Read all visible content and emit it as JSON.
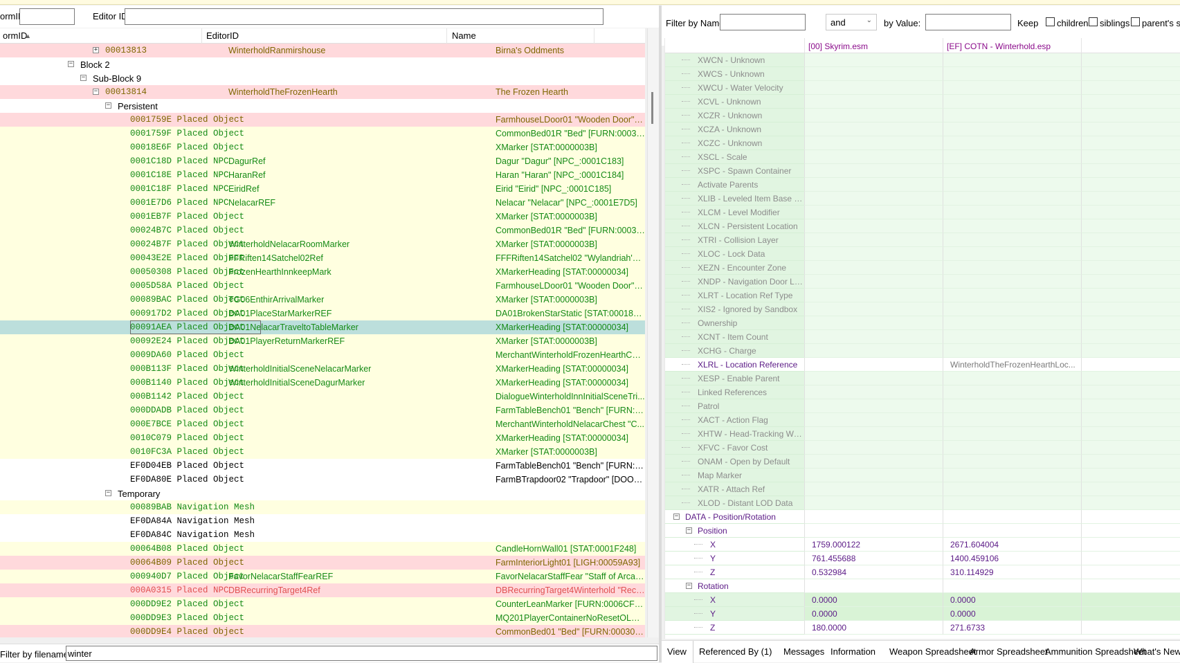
{
  "toolbar": {
    "formid_label": "ormID",
    "formid_value": "",
    "editorid_label": "Editor ID",
    "editorid_value": ""
  },
  "tree": {
    "columns": [
      "ormID",
      "EditorID",
      "Name"
    ],
    "rows": [
      {
        "indent": 5,
        "exp": "+",
        "fid": "00013813",
        "type": "",
        "eid": "WinterholdRanmirshouse",
        "name": "Birna's Oddments",
        "bg": "pink",
        "c": "olive"
      },
      {
        "indent": 3,
        "exp": "-",
        "label": "Block 2",
        "bg": "white",
        "c": "black"
      },
      {
        "indent": 4,
        "exp": "-",
        "label": "Sub-Block 9",
        "bg": "white",
        "c": "black"
      },
      {
        "indent": 5,
        "exp": "-",
        "fid": "00013814",
        "type": "",
        "eid": "WinterholdTheFrozenHearth",
        "name": "The Frozen Hearth",
        "bg": "pink",
        "c": "olive"
      },
      {
        "indent": 6,
        "exp": "-",
        "label": "Persistent",
        "bg": "white",
        "c": "black"
      },
      {
        "indent": 7,
        "fid": "0001759E",
        "type": "Placed Object",
        "eid": "",
        "name": "FarmhouseLDoor01 \"Wooden Door\" [...",
        "bg": "pink",
        "c": "olive"
      },
      {
        "indent": 7,
        "fid": "0001759F",
        "type": "Placed Object",
        "eid": "",
        "name": "CommonBed01R \"Bed\" [FURN:0003B4...",
        "bg": "yellow",
        "c": "green"
      },
      {
        "indent": 7,
        "fid": "00018E6F",
        "type": "Placed Object",
        "eid": "",
        "name": "XMarker [STAT:0000003B]",
        "bg": "yellow",
        "c": "green"
      },
      {
        "indent": 7,
        "fid": "0001C18D",
        "type": "Placed NPC",
        "eid": "DagurRef",
        "name": "Dagur \"Dagur\" [NPC_:0001C183]",
        "bg": "yellow",
        "c": "green"
      },
      {
        "indent": 7,
        "fid": "0001C18E",
        "type": "Placed NPC",
        "eid": "HaranRef",
        "name": "Haran \"Haran\" [NPC_:0001C184]",
        "bg": "yellow",
        "c": "green"
      },
      {
        "indent": 7,
        "fid": "0001C18F",
        "type": "Placed NPC",
        "eid": "EiridRef",
        "name": "Eirid \"Eirid\" [NPC_:0001C185]",
        "bg": "yellow",
        "c": "green"
      },
      {
        "indent": 7,
        "fid": "0001E7D6",
        "type": "Placed NPC",
        "eid": "NelacarREF",
        "name": "Nelacar \"Nelacar\" [NPC_:0001E7D5]",
        "bg": "yellow",
        "c": "green"
      },
      {
        "indent": 7,
        "fid": "0001EB7F",
        "type": "Placed Object",
        "eid": "",
        "name": "XMarker [STAT:0000003B]",
        "bg": "yellow",
        "c": "green"
      },
      {
        "indent": 7,
        "fid": "00024B7C",
        "type": "Placed Object",
        "eid": "",
        "name": "CommonBed01R \"Bed\" [FURN:0003B4...",
        "bg": "yellow",
        "c": "green"
      },
      {
        "indent": 7,
        "fid": "00024B7F",
        "type": "Placed Object",
        "eid": "WinterholdNelacarRoomMarker",
        "name": "XMarker [STAT:0000003B]",
        "bg": "yellow",
        "c": "green"
      },
      {
        "indent": 7,
        "fid": "00043E2E",
        "type": "Placed Object",
        "eid": "FFRiften14Satchel02Ref",
        "name": "FFFRiften14Satchel02 \"Wylandriah's Sa...",
        "bg": "yellow",
        "c": "green"
      },
      {
        "indent": 7,
        "fid": "00050308",
        "type": "Placed Object",
        "eid": "FrozenHearthInnkeepMark",
        "name": "XMarkerHeading [STAT:00000034]",
        "bg": "yellow",
        "c": "green"
      },
      {
        "indent": 7,
        "fid": "0005D58A",
        "type": "Placed Object",
        "eid": "",
        "name": "FarmhouseLDoor01 \"Wooden Door\" [...",
        "bg": "yellow",
        "c": "green"
      },
      {
        "indent": 7,
        "fid": "00089BAC",
        "type": "Placed Object",
        "eid": "TG06EnthirArrivalMarker",
        "name": "XMarker [STAT:0000003B]",
        "bg": "yellow",
        "c": "green"
      },
      {
        "indent": 7,
        "fid": "000917D2",
        "type": "Placed Object",
        "eid": "DA01PlaceStarMarkerREF",
        "name": "DA01BrokenStarStatic [STAT:00018E6E]",
        "bg": "yellow",
        "c": "green"
      },
      {
        "indent": 7,
        "fid": "00091AEA",
        "type": "Placed Object",
        "eid": "DA01NelacarTraveltoTableMarker",
        "name": "XMarkerHeading [STAT:00000034]",
        "bg": "selected",
        "c": "green"
      },
      {
        "indent": 7,
        "fid": "00092E24",
        "type": "Placed Object",
        "eid": "DA01PlayerReturnMarkerREF",
        "name": "XMarker [STAT:0000003B]",
        "bg": "yellow",
        "c": "green"
      },
      {
        "indent": 7,
        "fid": "0009DA60",
        "type": "Placed Object",
        "eid": "",
        "name": "MerchantWinterholdFrozenHearthChe...",
        "bg": "yellow",
        "c": "green"
      },
      {
        "indent": 7,
        "fid": "000B113F",
        "type": "Placed Object",
        "eid": "WinterholdInitialSceneNelacarMarker",
        "name": "XMarkerHeading [STAT:00000034]",
        "bg": "yellow",
        "c": "green"
      },
      {
        "indent": 7,
        "fid": "000B1140",
        "type": "Placed Object",
        "eid": "WinterholdInitialSceneDagurMarker",
        "name": "XMarkerHeading [STAT:00000034]",
        "bg": "yellow",
        "c": "green"
      },
      {
        "indent": 7,
        "fid": "000B1142",
        "type": "Placed Object",
        "eid": "",
        "name": "DialogueWinterholdInnInitialSceneTri...",
        "bg": "yellow",
        "c": "green"
      },
      {
        "indent": 7,
        "fid": "000DDADB",
        "type": "Placed Object",
        "eid": "",
        "name": "FarmTableBench01 \"Bench\" [FURN:00...",
        "bg": "yellow",
        "c": "green"
      },
      {
        "indent": 7,
        "fid": "000E7BCE",
        "type": "Placed Object",
        "eid": "",
        "name": "MerchantWinterholdNelacarChest \"C...",
        "bg": "yellow",
        "c": "green"
      },
      {
        "indent": 7,
        "fid": "0010C079",
        "type": "Placed Object",
        "eid": "",
        "name": "XMarkerHeading [STAT:00000034]",
        "bg": "yellow",
        "c": "green"
      },
      {
        "indent": 7,
        "fid": "0010FC3A",
        "type": "Placed Object",
        "eid": "",
        "name": "XMarker [STAT:0000003B]",
        "bg": "yellow",
        "c": "green"
      },
      {
        "indent": 7,
        "fid": "EF0D04EB",
        "type": "Placed Object",
        "eid": "",
        "name": "FarmTableBench01 \"Bench\" [FURN:00...",
        "bg": "white",
        "c": "black"
      },
      {
        "indent": 7,
        "fid": "EF0DA80E",
        "type": "Placed Object",
        "eid": "",
        "name": "FarmBTrapdoor02 \"Trapdoor\" [DOOR:...",
        "bg": "white",
        "c": "black"
      },
      {
        "indent": 6,
        "exp": "-",
        "label": "Temporary",
        "bg": "white",
        "c": "black"
      },
      {
        "indent": 7,
        "fid": "00089BAB",
        "type": "Navigation Mesh",
        "eid": "",
        "name": "",
        "bg": "yellow",
        "c": "green"
      },
      {
        "indent": 7,
        "fid": "EF0DA84A",
        "type": "Navigation Mesh",
        "eid": "",
        "name": "",
        "bg": "white",
        "c": "black"
      },
      {
        "indent": 7,
        "fid": "EF0DA84C",
        "type": "Navigation Mesh",
        "eid": "",
        "name": "",
        "bg": "white",
        "c": "black"
      },
      {
        "indent": 7,
        "fid": "00064B08",
        "type": "Placed Object",
        "eid": "",
        "name": "CandleHornWall01 [STAT:0001F248]",
        "bg": "yellow",
        "c": "green"
      },
      {
        "indent": 7,
        "fid": "00064B09",
        "type": "Placed Object",
        "eid": "",
        "name": "FarmInteriorLight01 [LIGH:00059A93]",
        "bg": "pink",
        "c": "olive"
      },
      {
        "indent": 7,
        "fid": "000940D7",
        "type": "Placed Object",
        "eid": "FavorNelacarStaffFearREF",
        "name": "FavorNelacarStaffFear \"Staff of Arcane...",
        "bg": "yellow",
        "c": "green"
      },
      {
        "indent": 7,
        "fid": "000A0315",
        "type": "Placed NPC",
        "eid": "DBRecurringTarget4Ref",
        "name": "DBRecurringTarget4Winterhold \"Reckl...",
        "bg": "pink",
        "c": "red"
      },
      {
        "indent": 7,
        "fid": "000DD9E2",
        "type": "Placed Object",
        "eid": "",
        "name": "CounterLeanMarker [FURN:0006CF36]",
        "bg": "yellow",
        "c": "green"
      },
      {
        "indent": 7,
        "fid": "000DD9E3",
        "type": "Placed Object",
        "eid": "",
        "name": "MQ201PlayerContainerNoResetOLD \"...",
        "bg": "yellow",
        "c": "green"
      },
      {
        "indent": 7,
        "fid": "000DD9E4",
        "type": "Placed Object",
        "eid": "",
        "name": "CommonBed01 \"Bed\" [FURN:00030091]",
        "bg": "pink",
        "c": "olive"
      }
    ]
  },
  "filter": {
    "label": "Filter by filename:",
    "value": "winter"
  },
  "right_filter": {
    "name_label": "Filter by Name:",
    "name_value": "",
    "op_value": "and",
    "value_label": "by Value:",
    "value_value": "",
    "keep_label": "Keep",
    "children_label": "children",
    "siblings_label": "siblings",
    "parents_label": "parent's siblin"
  },
  "record_view": {
    "columns": [
      "",
      "[00] Skyrim.esm",
      "[EF] COTN - Winterhold.esp",
      ""
    ],
    "rows": [
      {
        "name": "XWCN - Unknown",
        "v1": "",
        "v2": "",
        "s": "g",
        "lvl": 1
      },
      {
        "name": "XWCS - Unknown",
        "v1": "",
        "v2": "",
        "s": "g",
        "lvl": 1
      },
      {
        "name": "XWCU - Water Velocity",
        "v1": "",
        "v2": "",
        "s": "g",
        "lvl": 1
      },
      {
        "name": "XCVL - Unknown",
        "v1": "",
        "v2": "",
        "s": "g",
        "lvl": 1
      },
      {
        "name": "XCZR - Unknown",
        "v1": "",
        "v2": "",
        "s": "g",
        "lvl": 1
      },
      {
        "name": "XCZA - Unknown",
        "v1": "",
        "v2": "",
        "s": "g",
        "lvl": 1
      },
      {
        "name": "XCZC - Unknown",
        "v1": "",
        "v2": "",
        "s": "g",
        "lvl": 1
      },
      {
        "name": "XSCL - Scale",
        "v1": "",
        "v2": "",
        "s": "g",
        "lvl": 1
      },
      {
        "name": "XSPC - Spawn Container",
        "v1": "",
        "v2": "",
        "s": "g",
        "lvl": 1
      },
      {
        "name": "Activate Parents",
        "v1": "",
        "v2": "",
        "s": "g",
        "lvl": 1
      },
      {
        "name": "XLIB - Leveled Item Base Obj...",
        "v1": "",
        "v2": "",
        "s": "g",
        "lvl": 1
      },
      {
        "name": "XLCM - Level Modifier",
        "v1": "",
        "v2": "",
        "s": "g",
        "lvl": 1
      },
      {
        "name": "XLCN - Persistent Location",
        "v1": "",
        "v2": "",
        "s": "g",
        "lvl": 1
      },
      {
        "name": "XTRI - Collision Layer",
        "v1": "",
        "v2": "",
        "s": "g",
        "lvl": 1
      },
      {
        "name": "XLOC - Lock Data",
        "v1": "",
        "v2": "",
        "s": "g",
        "lvl": 1
      },
      {
        "name": "XEZN - Encounter Zone",
        "v1": "",
        "v2": "",
        "s": "g",
        "lvl": 1
      },
      {
        "name": "XNDP - Navigation Door Link",
        "v1": "",
        "v2": "",
        "s": "g",
        "lvl": 1
      },
      {
        "name": "XLRT - Location Ref Type",
        "v1": "",
        "v2": "",
        "s": "g",
        "lvl": 1
      },
      {
        "name": "XIS2 - Ignored by Sandbox",
        "v1": "",
        "v2": "",
        "s": "g",
        "lvl": 1
      },
      {
        "name": "Ownership",
        "v1": "",
        "v2": "",
        "s": "g",
        "lvl": 1
      },
      {
        "name": "XCNT - Item Count",
        "v1": "",
        "v2": "",
        "s": "g",
        "lvl": 1
      },
      {
        "name": "XCHG - Charge",
        "v1": "",
        "v2": "",
        "s": "g",
        "lvl": 1
      },
      {
        "name": "XLRL - Location Reference",
        "v1": "",
        "v2": "WinterholdTheFrozenHearthLoc...",
        "s": "w",
        "lvl": 1
      },
      {
        "name": "XESP - Enable Parent",
        "v1": "",
        "v2": "",
        "s": "g",
        "lvl": 1
      },
      {
        "name": "Linked References",
        "v1": "",
        "v2": "",
        "s": "g",
        "lvl": 1
      },
      {
        "name": "Patrol",
        "v1": "",
        "v2": "",
        "s": "g",
        "lvl": 1
      },
      {
        "name": "XACT - Action Flag",
        "v1": "",
        "v2": "",
        "s": "g",
        "lvl": 1
      },
      {
        "name": "XHTW - Head-Tracking Weig...",
        "v1": "",
        "v2": "",
        "s": "g",
        "lvl": 1
      },
      {
        "name": "XFVC - Favor Cost",
        "v1": "",
        "v2": "",
        "s": "g",
        "lvl": 1
      },
      {
        "name": "ONAM - Open by Default",
        "v1": "",
        "v2": "",
        "s": "g",
        "lvl": 1
      },
      {
        "name": "Map Marker",
        "v1": "",
        "v2": "",
        "s": "g",
        "lvl": 1
      },
      {
        "name": "XATR - Attach Ref",
        "v1": "",
        "v2": "",
        "s": "g",
        "lvl": 1
      },
      {
        "name": "XLOD - Distant LOD Data",
        "v1": "",
        "v2": "",
        "s": "g",
        "lvl": 1
      },
      {
        "name": "DATA - Position/Rotation",
        "v1": "",
        "v2": "",
        "s": "w",
        "lvl": 0,
        "exp": "-"
      },
      {
        "name": "Position",
        "v1": "",
        "v2": "",
        "s": "w",
        "lvl": 1,
        "exp": "-"
      },
      {
        "name": "X",
        "v1": "1759.000122",
        "v2": "2671.604004",
        "s": "w",
        "lvl": 2
      },
      {
        "name": "Y",
        "v1": "761.455688",
        "v2": "1400.459106",
        "s": "w",
        "lvl": 2
      },
      {
        "name": "Z",
        "v1": "0.532984",
        "v2": "310.114929",
        "s": "w",
        "lvl": 2
      },
      {
        "name": "Rotation",
        "v1": "",
        "v2": "",
        "s": "w",
        "lvl": 1,
        "exp": "-"
      },
      {
        "name": "X",
        "v1": "0.0000",
        "v2": "0.0000",
        "s": "gg",
        "lvl": 2
      },
      {
        "name": "Y",
        "v1": "0.0000",
        "v2": "0.0000",
        "s": "gg",
        "lvl": 2
      },
      {
        "name": "Z",
        "v1": "180.0000",
        "v2": "271.6733",
        "s": "w",
        "lvl": 2
      }
    ]
  },
  "tabs": [
    "View",
    "Referenced By (1)",
    "Messages",
    "Information",
    "Weapon Spreadsheet",
    "Armor Spreadsheet",
    "Ammunition Spreadsheet",
    "What's New"
  ]
}
